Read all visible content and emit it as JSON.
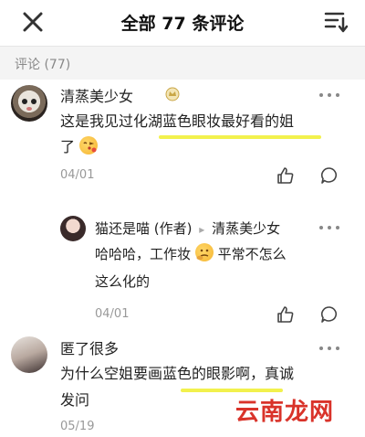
{
  "header": {
    "title": "全部 77 条评论"
  },
  "section": {
    "label": "评论 (77)"
  },
  "comments": [
    {
      "name": "清蒸美少女",
      "text_line1": "这是我见过化湖蓝色眼妆最好看的姐",
      "text_line2": "了",
      "date": "04/01",
      "reply": {
        "name": "猫还是喵",
        "role": "(作者)",
        "target": "清蒸美少女",
        "text_line1a": "哈哈哈，工作妆",
        "text_line1b": "平常不怎么",
        "text_line2": "这么化的",
        "date": "04/01"
      }
    },
    {
      "name": "匿了很多",
      "text_line1": "为什么空姐要画蓝色的眼影啊，真诚",
      "text_line2": "发问",
      "date": "05/19"
    }
  ],
  "watermark": "云南龙网",
  "icons": {
    "close": "close-icon",
    "sort": "sort-icon",
    "more": "more-icon",
    "like": "thumbs-up-icon",
    "reply": "reply-bubble-icon"
  },
  "colors": {
    "highlight": "#f1f03a",
    "watermark": "#d9332a",
    "section_bg": "#f4f4f4"
  }
}
